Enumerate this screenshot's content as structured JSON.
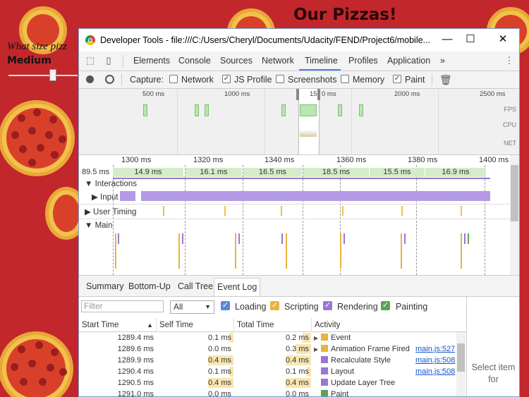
{
  "background": {
    "title": "Our Pizzas!",
    "question": "What size pizz",
    "size_label": "Medium"
  },
  "window": {
    "title": "Developer Tools - file:///C:/Users/Cheryl/Documents/Udacity/FEND/Project6/mobile...",
    "minimize": "—",
    "maximize": "☐",
    "close": "✕"
  },
  "tabs": [
    "Elements",
    "Console",
    "Sources",
    "Network",
    "Timeline",
    "Profiles",
    "Application",
    "»"
  ],
  "capture": {
    "label": "Capture:",
    "options": [
      {
        "label": "Network",
        "checked": false
      },
      {
        "label": "JS Profile",
        "checked": true
      },
      {
        "label": "Screenshots",
        "checked": false
      },
      {
        "label": "Memory",
        "checked": false
      },
      {
        "label": "Paint",
        "checked": true
      }
    ]
  },
  "overview": {
    "ticks": [
      "500 ms",
      "1000 ms",
      "15",
      "0 ms",
      "2000 ms",
      "2500 ms"
    ],
    "labels": [
      "FPS",
      "CPU",
      "NET"
    ]
  },
  "flamechart": {
    "ticks": [
      "1300 ms",
      "1320 ms",
      "1340 ms",
      "1360 ms",
      "1380 ms",
      "1400 ms"
    ],
    "frames": [
      "89.5 ms",
      "14.9 ms",
      "16.1 ms",
      "16.5 ms",
      "18.5 ms",
      "15.5 ms",
      "16.9 ms"
    ],
    "tracks": {
      "interactions": "Interactions",
      "input": "Input",
      "user_timing": "User Timing",
      "main": "Main"
    }
  },
  "bottom_tabs": [
    "Summary",
    "Bottom-Up",
    "Call Tree",
    "Event Log"
  ],
  "filter": {
    "placeholder": "Filter",
    "select_value": "All",
    "categories": [
      {
        "label": "Loading",
        "color": "#5a89d8"
      },
      {
        "label": "Scripting",
        "color": "#e8b33e"
      },
      {
        "label": "Rendering",
        "color": "#9b76d6"
      },
      {
        "label": "Painting",
        "color": "#5aa35a"
      }
    ]
  },
  "table": {
    "columns": [
      "Start Time",
      "Self Time",
      "Total Time",
      "Activity"
    ],
    "rows": [
      {
        "start": "1289.4 ms",
        "self": "0.1 ms",
        "total": "0.2 ms",
        "activity": "Event",
        "color": "#e8b33e",
        "expand": "▶",
        "link": ""
      },
      {
        "start": "1289.6 ms",
        "self": "0.0 ms",
        "total": "0.3 ms",
        "activity": "Animation Frame Fired",
        "color": "#e8b33e",
        "expand": "▶",
        "link": "main.js:527"
      },
      {
        "start": "1289.9 ms",
        "self": "0.4 ms",
        "total": "0.4 ms",
        "activity": "Recalculate Style",
        "color": "#9b76d6",
        "expand": "",
        "link": "main.js:508"
      },
      {
        "start": "1290.4 ms",
        "self": "0.1 ms",
        "total": "0.1 ms",
        "activity": "Layout",
        "color": "#9b76d6",
        "expand": "",
        "link": "main.js:508"
      },
      {
        "start": "1290.5 ms",
        "self": "0.4 ms",
        "total": "0.4 ms",
        "activity": "Update Layer Tree",
        "color": "#9b76d6",
        "expand": "",
        "link": ""
      },
      {
        "start": "1291.0 ms",
        "self": "0.0 ms",
        "total": "0.0 ms",
        "activity": "Paint",
        "color": "#5aa35a",
        "expand": "",
        "link": ""
      }
    ]
  },
  "side_pane": "Select item for"
}
